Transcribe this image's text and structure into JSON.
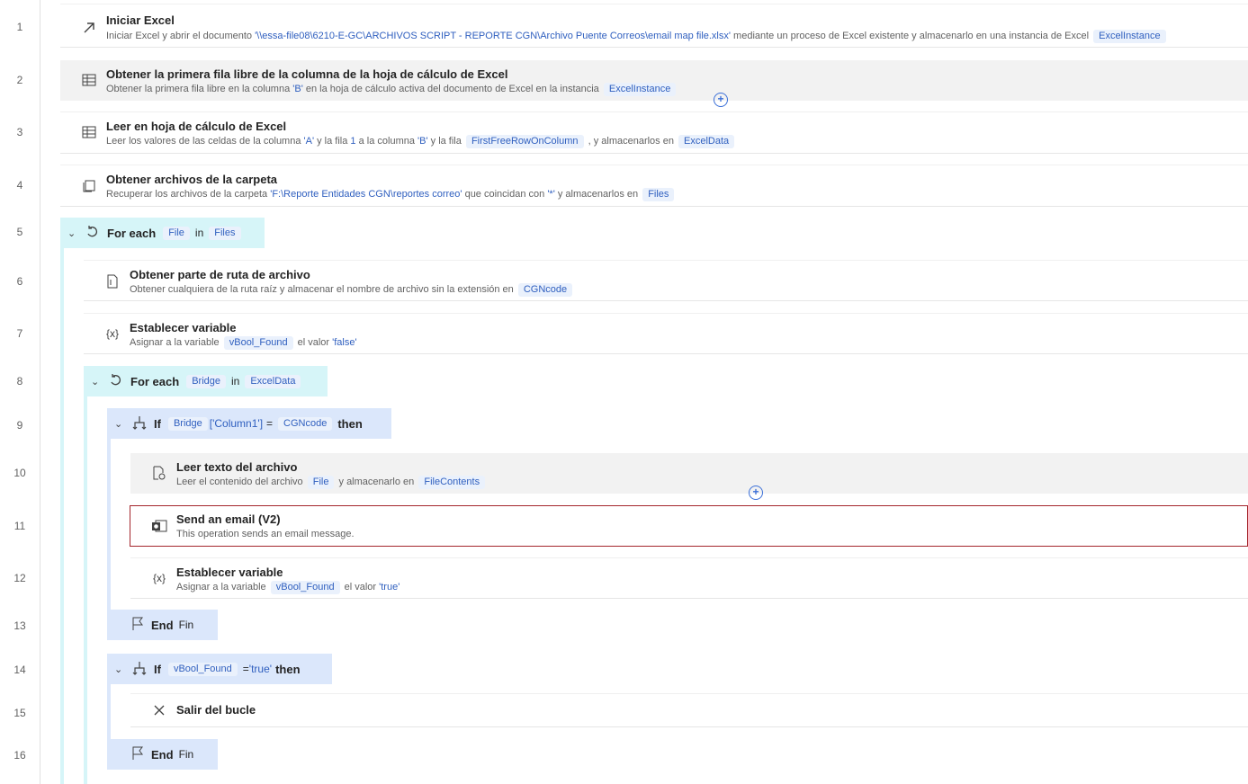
{
  "line_numbers": [
    "1",
    "2",
    "3",
    "4",
    "5",
    "6",
    "7",
    "8",
    "9",
    "10",
    "11",
    "12",
    "13",
    "14",
    "15",
    "16"
  ],
  "actions": {
    "a1": {
      "title": "Iniciar Excel",
      "desc_pre": "Iniciar Excel y abrir el documento ",
      "path": "'\\\\essa-file08\\6210-E-GC\\ARCHIVOS SCRIPT - REPORTE CGN\\Archivo Puente Correos\\email map file.xlsx'",
      "desc_mid": " mediante un proceso de Excel existente y almacenarlo en una instancia de Excel ",
      "var": "ExcelInstance"
    },
    "a2": {
      "title": "Obtener la primera fila libre de la columna de la hoja de cálculo de Excel",
      "desc_pre": "Obtener la primera fila libre en la columna ",
      "col": "'B'",
      "desc_mid": " en la hoja de cálculo activa del documento de Excel en la instancia ",
      "var": "ExcelInstance"
    },
    "a3": {
      "title": "Leer en hoja de cálculo de Excel",
      "p1": "Leer los valores de las celdas de la columna ",
      "colA": "'A'",
      "p2": " y la fila ",
      "row": "1",
      "p3": " a la columna ",
      "colB": "'B'",
      "p4": " y la fila ",
      "var1": "FirstFreeRowOnColumn",
      "p5": " , y almacenarlos en ",
      "var2": "ExcelData"
    },
    "a4": {
      "title": "Obtener archivos de la carpeta",
      "p1": "Recuperar los archivos de la carpeta ",
      "folder": "'F:\\Reporte Entidades CGN\\reportes correo'",
      "p2": " que coincidan con ",
      "pattern": "'*'",
      "p3": " y almacenarlos en ",
      "var": "Files"
    },
    "a5": {
      "keyword": "For each",
      "item": "File",
      "in": "in",
      "list": "Files"
    },
    "a6": {
      "title": "Obtener parte de ruta de archivo",
      "p1": "Obtener cualquiera de la ruta raíz y almacenar el nombre de archivo sin la extensión en ",
      "var": "CGNcode"
    },
    "a7": {
      "title": "Establecer variable",
      "p1": "Asignar a la variable ",
      "var": "vBool_Found",
      "p2": " el valor ",
      "val": "'false'"
    },
    "a8": {
      "keyword": "For each",
      "item": "Bridge",
      "in": "in",
      "list": "ExcelData"
    },
    "a9": {
      "keyword": "If",
      "var": "Bridge",
      "index": "['Column1']",
      "op": "=",
      "var2": "CGNcode",
      "then": "then"
    },
    "a10": {
      "title": "Leer texto del archivo",
      "p1": "Leer el contenido del archivo ",
      "var1": "File",
      "p2": " y almacenarlo en ",
      "var2": "FileContents"
    },
    "a11": {
      "title": "Send an email (V2)",
      "desc": "This operation sends an email message."
    },
    "a12": {
      "title": "Establecer variable",
      "p1": "Asignar a la variable ",
      "var": "vBool_Found",
      "p2": " el valor ",
      "val": "'true'"
    },
    "a13": {
      "keyword": "End",
      "sub": "Fin"
    },
    "a14": {
      "keyword": "If",
      "var": "vBool_Found",
      "op": "=",
      "val": "'true'",
      "then": "then"
    },
    "a15": {
      "title": "Salir del bucle"
    },
    "a16": {
      "keyword": "End",
      "sub": "Fin"
    }
  },
  "icons": {
    "a1": "launch-arrow-icon",
    "a2": "excel-icon",
    "a3": "excel-icon",
    "a4": "folder-files-icon",
    "loop": "loop-icon",
    "a6": "file-path-icon",
    "var": "variable-icon",
    "if": "condition-icon",
    "a10": "file-read-icon",
    "a11": "outlook-icon",
    "end": "flag-icon",
    "exit": "close-icon",
    "ai": "copilot-add-icon"
  },
  "colors": {
    "loop_bg": "#d6f5f8",
    "if_bg": "#dbe7fb",
    "error_border": "#a4262c",
    "token": "#2f5fbf"
  }
}
